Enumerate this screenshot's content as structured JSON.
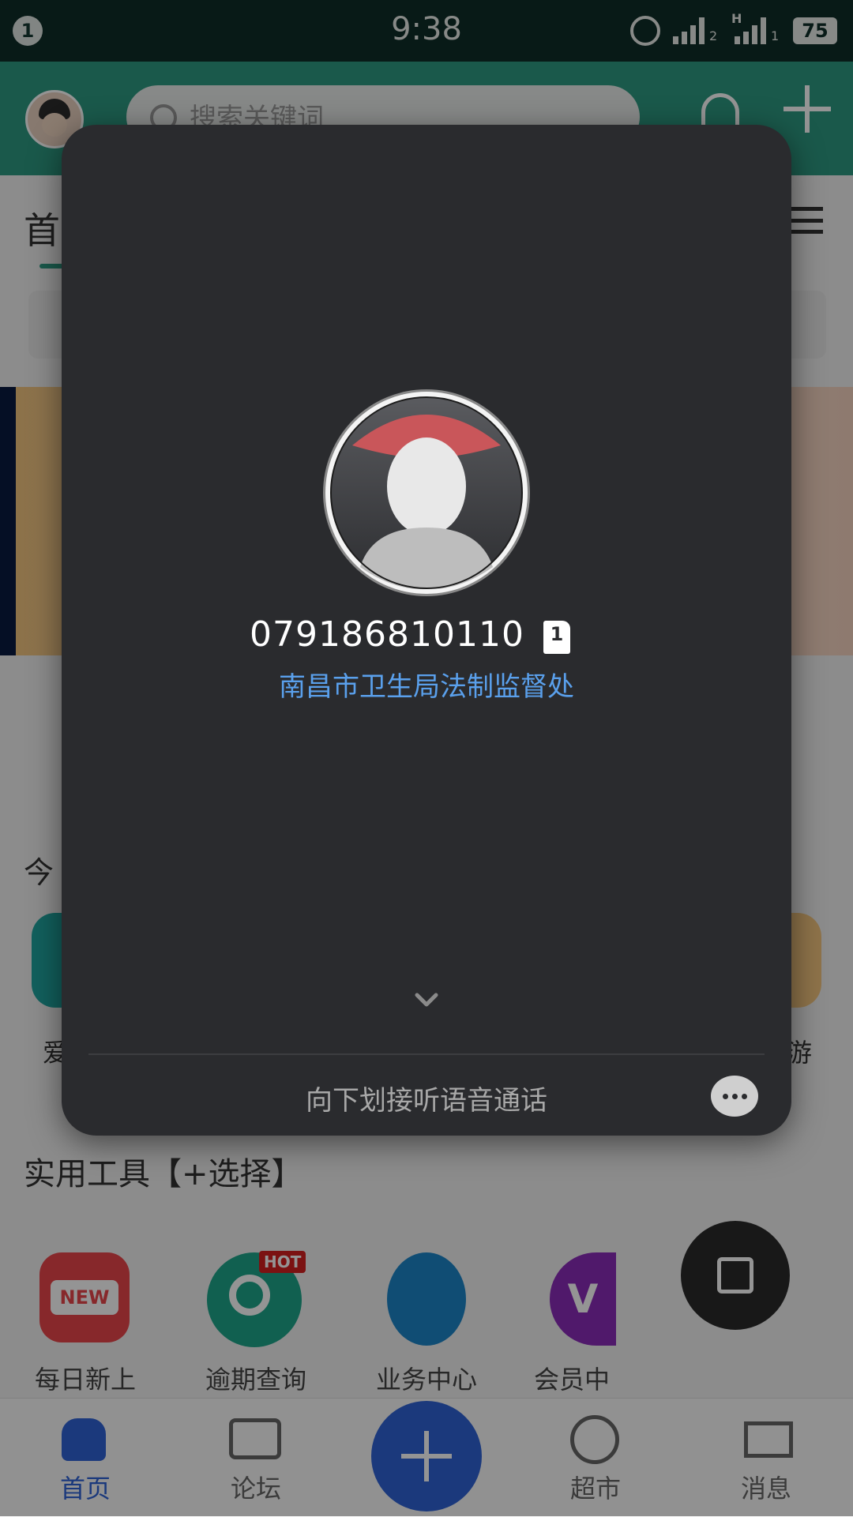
{
  "status_bar": {
    "notification_count": "1",
    "time": "9:38",
    "battery": "75",
    "sim1_label": "2",
    "sim2_label": "1",
    "network_type": "H"
  },
  "header": {
    "search_placeholder": "搜索关键词"
  },
  "background": {
    "tab_active_partial": "首",
    "section_today_partial": "今",
    "tile_text_partial_left": "爱",
    "tile_text_partial_right": "游",
    "tools_section_title": "实用工具【+选择】",
    "tools": [
      {
        "label": "每日新上",
        "icon": "new-tag-icon",
        "badge": "NEW",
        "color": "#e9464a"
      },
      {
        "label": "逾期查询",
        "icon": "search-magnifier-icon",
        "badge": "HOT",
        "color": "#1ea58a"
      },
      {
        "label": "业务中心",
        "icon": "business-center-icon",
        "color": "#1d86c8"
      },
      {
        "label": "会员中",
        "icon": "vip-icon",
        "color": "#8b2bb8"
      }
    ]
  },
  "bottom_nav": {
    "items": [
      {
        "label": "首页",
        "icon": "home-icon",
        "active": true
      },
      {
        "label": "论坛",
        "icon": "forum-icon",
        "active": false
      },
      {
        "label": "超市",
        "icon": "market-icon",
        "active": false
      },
      {
        "label": "消息",
        "icon": "mail-icon",
        "active": false
      }
    ]
  },
  "incoming_call": {
    "number": "079186810110",
    "sim_slot": "1",
    "caller_label": "南昌市卫生局法制监督处",
    "swipe_hint": "向下划接听语音通话"
  },
  "colors": {
    "brand_green": "#2e9a82",
    "call_card_bg": "#2a2b2e",
    "caller_label": "#5aa0ec",
    "nav_active": "#2f62d6"
  }
}
